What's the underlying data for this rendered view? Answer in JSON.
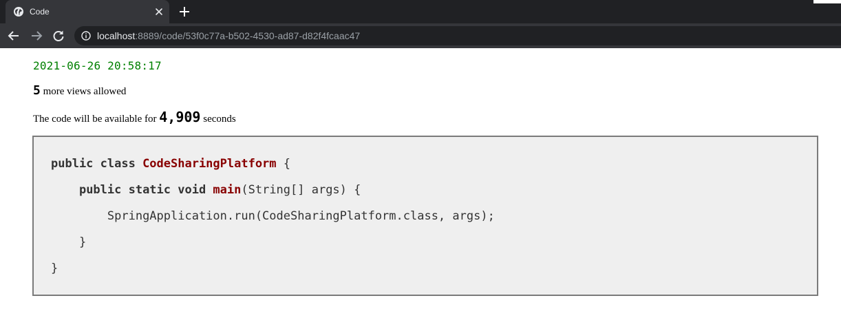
{
  "browser": {
    "tab": {
      "title": "Code"
    },
    "url": {
      "host": "localhost",
      "path": ":8889/code/53f0c77a-b502-4530-ad87-d82f4fcaac47"
    }
  },
  "snippet": {
    "date": "2021-06-26 20:58:17",
    "views": {
      "count": "5",
      "label": " more views allowed"
    },
    "time": {
      "prefix": "The code will be available for ",
      "seconds": "4,909",
      "suffix": " seconds"
    },
    "code_lines": [
      {
        "indent": "",
        "kw": "public class ",
        "ident": "CodeSharingPlatform",
        "rest": " {"
      },
      {
        "indent": "    ",
        "kw": "public static void ",
        "ident": "main",
        "rest": "(String[] args) {"
      },
      {
        "indent": "        ",
        "kw": "",
        "ident": "",
        "rest": "SpringApplication.run(CodeSharingPlatform.class, args);"
      },
      {
        "indent": "    ",
        "kw": "",
        "ident": "",
        "rest": "}"
      },
      {
        "indent": "",
        "kw": "",
        "ident": "",
        "rest": "}"
      }
    ]
  },
  "colors": {
    "date": "#008000",
    "keyword_ident": "#880000",
    "code_background": "#efefef"
  },
  "icons": {
    "tab_icon": "globe-icon",
    "tab_close": "close-icon",
    "new_tab": "plus-icon",
    "back": "arrow-left-icon",
    "forward": "arrow-right-icon",
    "reload": "reload-icon",
    "site_info": "info-icon"
  }
}
